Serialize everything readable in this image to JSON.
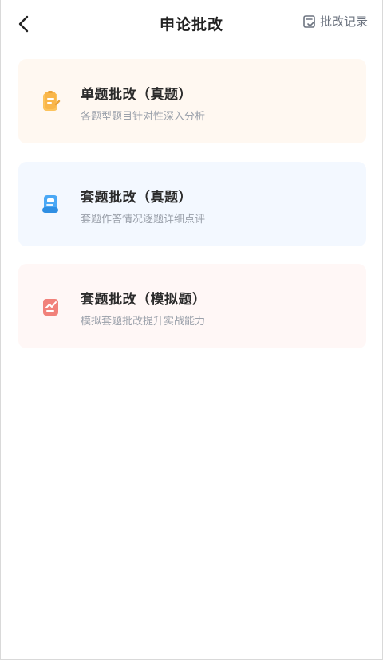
{
  "header": {
    "title": "申论批改",
    "record_label": "批改记录"
  },
  "cards": [
    {
      "title": "单题批改（真题）",
      "desc": "各题型题目针对性深入分析",
      "accent": "#f9b64a"
    },
    {
      "title": "套题批改（真题）",
      "desc": "套题作答情况逐题详细点评",
      "accent": "#4aa8f5"
    },
    {
      "title": "套题批改（模拟题）",
      "desc": "模拟套题批改提升实战能力",
      "accent": "#f1817a"
    }
  ],
  "icons": {
    "back": "chevron-left-icon",
    "record": "record-check-icon",
    "card_1": "clipboard-edit-icon",
    "card_2": "scroll-icon",
    "card_3": "chart-paper-icon"
  }
}
